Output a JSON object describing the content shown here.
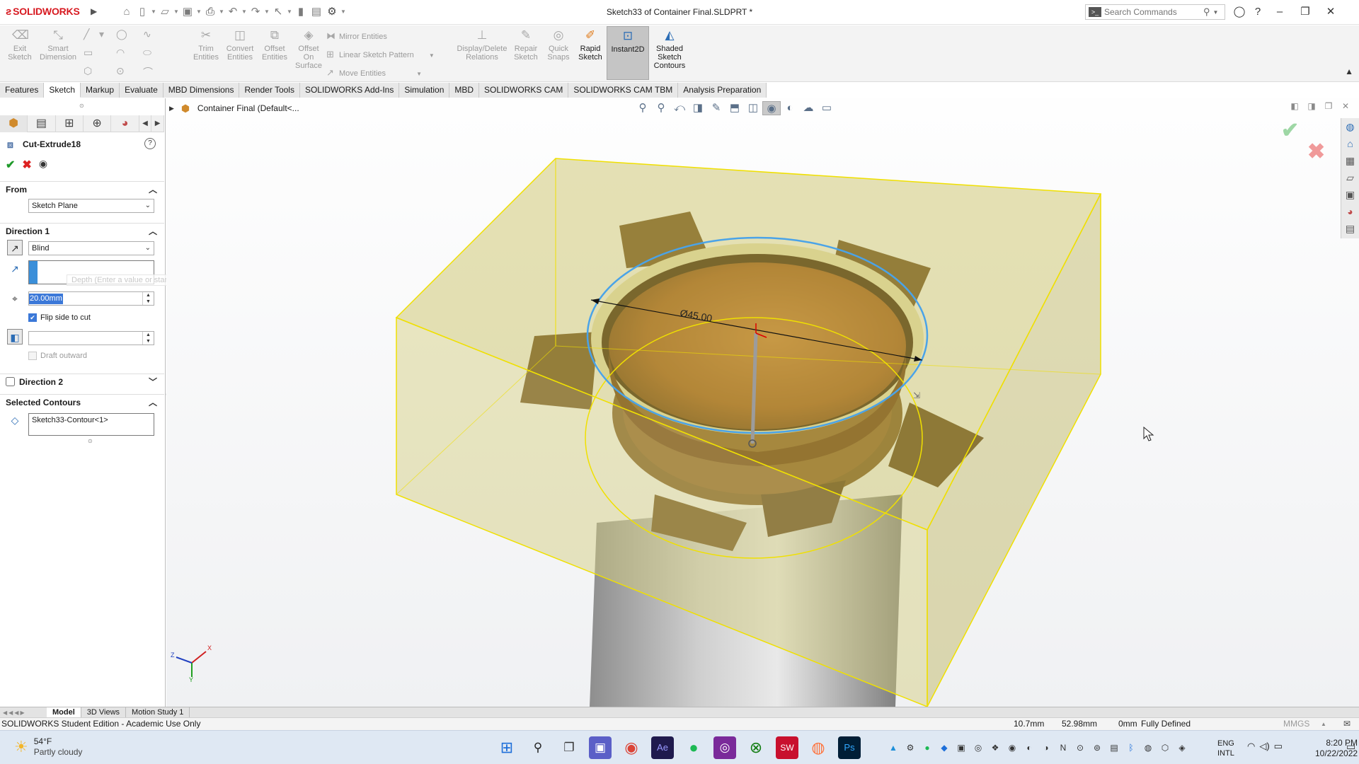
{
  "app": {
    "brand": "SOLIDWORKS",
    "document_title": "Sketch33 of Container Final.SLDPRT *"
  },
  "search": {
    "placeholder": "Search Commands"
  },
  "ribbon": {
    "exit_sketch": "Exit Sketch",
    "smart_dimension": "Smart Dimension",
    "trim_entities": "Trim Entities",
    "convert_entities": "Convert Entities",
    "offset_entities": "Offset Entities",
    "offset_on_surface": "Offset On Surface",
    "mirror_entities": "Mirror Entities",
    "linear_sketch_pattern": "Linear Sketch Pattern",
    "move_entities": "Move Entities",
    "display_delete_relations": "Display/Delete Relations",
    "repair_sketch": "Repair Sketch",
    "quick_snaps": "Quick Snaps",
    "rapid_sketch": "Rapid Sketch",
    "instant2d": "Instant2D",
    "shaded_sketch_contours": "Shaded Sketch Contours"
  },
  "tabs": [
    {
      "label": "Features",
      "active": false
    },
    {
      "label": "Sketch",
      "active": true
    },
    {
      "label": "Markup",
      "active": false
    },
    {
      "label": "Evaluate",
      "active": false
    },
    {
      "label": "MBD Dimensions",
      "active": false
    },
    {
      "label": "Render Tools",
      "active": false
    },
    {
      "label": "SOLIDWORKS Add-Ins",
      "active": false
    },
    {
      "label": "Simulation",
      "active": false
    },
    {
      "label": "MBD",
      "active": false
    },
    {
      "label": "SOLIDWORKS CAM",
      "active": false
    },
    {
      "label": "SOLIDWORKS CAM TBM",
      "active": false
    },
    {
      "label": "Analysis Preparation",
      "active": false
    }
  ],
  "property_manager": {
    "title": "Cut-Extrude18",
    "from": {
      "header": "From",
      "selected": "Sketch Plane"
    },
    "direction1": {
      "header": "Direction 1",
      "end_condition": "Blind",
      "depth_tooltip": "Depth (Enter a value or start with = to create an equation)",
      "depth_value": "20.00mm",
      "flip_side_label": "Flip side to cut",
      "flip_side_checked": true,
      "draft_outward_label": "Draft outward",
      "draft_outward_checked": false
    },
    "direction2": {
      "header": "Direction 2",
      "checked": false
    },
    "selected_contours": {
      "header": "Selected Contours",
      "items": [
        "Sketch33-Contour<1>"
      ]
    }
  },
  "graphics": {
    "tree_root": "Container Final  (Default<...",
    "dimension_label": "Ø45.00",
    "colors": {
      "body_brown": "#8a5a24",
      "transparent_box": "#c8be5a",
      "box_edge": "#f0e000",
      "sketch_circle": "#4aa3e8",
      "cylinder": "#a8a8a8"
    },
    "triad": {
      "x": "X",
      "y": "Y",
      "z": "Z"
    }
  },
  "bottom_tabs": [
    {
      "label": "Model",
      "active": true
    },
    {
      "label": "3D Views",
      "active": false
    },
    {
      "label": "Motion Study 1",
      "active": false
    }
  ],
  "status": {
    "edition": "SOLIDWORKS Student Edition - Academic Use Only",
    "x": "10.7mm",
    "y": "52.98mm",
    "z": "0mm",
    "state": "Fully Defined",
    "units": "MMGS"
  },
  "taskbar": {
    "temperature": "54°F",
    "weather": "Partly cloudy",
    "lang1": "ENG",
    "lang2": "INTL",
    "time": "8:20 PM",
    "date": "10/22/2022"
  }
}
